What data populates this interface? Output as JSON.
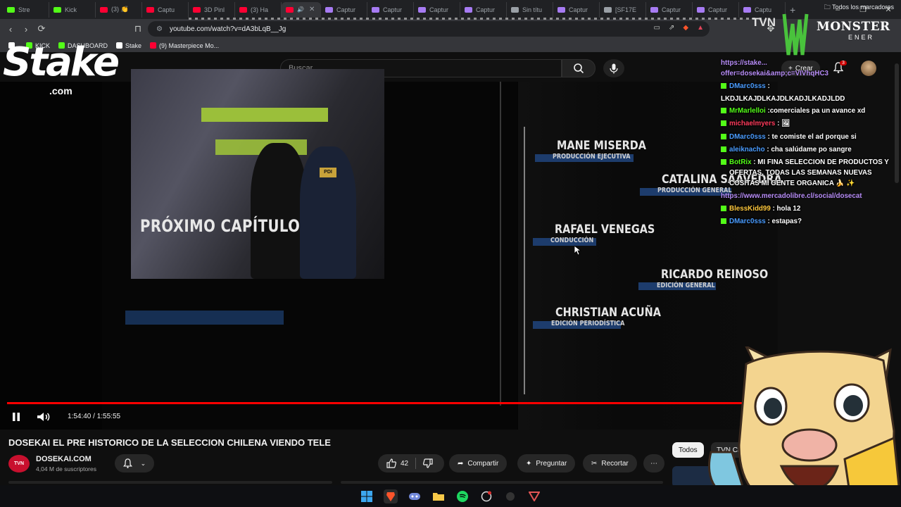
{
  "browser": {
    "tabs": [
      {
        "label": "Stre",
        "color": "#53fc18"
      },
      {
        "label": "Kick",
        "color": "#53fc18"
      },
      {
        "label": "(3) 👏",
        "color": "#ff0033"
      },
      {
        "label": "Captu",
        "color": "#ff0033"
      },
      {
        "label": "3D Pinl",
        "color": "#ff0033"
      },
      {
        "label": "(3) Ha",
        "color": "#ff0033"
      },
      {
        "label": "",
        "color": "#ff0033",
        "active": true
      },
      {
        "label": "Captur",
        "color": "#a77bf3"
      },
      {
        "label": "Captur",
        "color": "#a77bf3"
      },
      {
        "label": "Captur",
        "color": "#a77bf3"
      },
      {
        "label": "Captur",
        "color": "#a77bf3"
      },
      {
        "label": "Sin títu",
        "color": "#9aa0a6"
      },
      {
        "label": "Captur",
        "color": "#a77bf3"
      },
      {
        "label": "[SF17E",
        "color": "#9aa0a6"
      },
      {
        "label": "Captur",
        "color": "#a77bf3"
      },
      {
        "label": "Captur",
        "color": "#a77bf3"
      },
      {
        "label": "Captu",
        "color": "#a77bf3"
      }
    ],
    "new_tab": "+",
    "window_controls": [
      "–",
      "❐",
      "✕"
    ],
    "url": "youtube.com/watch?v=dA3bLqB__Jg",
    "bookmarks": [
      {
        "label": "",
        "color": "#ffffff"
      },
      {
        "label": "KICK",
        "color": "#53fc18"
      },
      {
        "label": "DASHBOARD",
        "color": "#53fc18"
      },
      {
        "label": "Stake",
        "color": "#ffffff"
      },
      {
        "label": "(9) Masterpiece Mo...",
        "color": "#ff0033"
      }
    ],
    "all_bookmarks": "Todos los marcadores"
  },
  "youtube": {
    "search_placeholder": "Buscar",
    "create_label": "Crear",
    "notification_count": "3"
  },
  "overlays": {
    "stake_logo": "Stake",
    "stake_com": ".com",
    "monster_logo": "MONSTER",
    "monster_sub": "ENER"
  },
  "video": {
    "promo_label": "PRÓXIMO CAPÍTULO",
    "network_bug": "TVN",
    "credits": [
      {
        "name": "MANE MISERDA",
        "role": "PRODUCCIÓN EJECUTIVA"
      },
      {
        "name": "CATALINA SAAVEDRA",
        "role": "PRODUCCIÓN GENERAL"
      },
      {
        "name": "RAFAEL VENEGAS",
        "role": "CONDUCCIÓN"
      },
      {
        "name": "RICARDO REINOSO",
        "role": "EDICIÓN GENERAL"
      },
      {
        "name": "CHRISTIAN ACUÑA",
        "role": "EDICIÓN PERIODÍSTICA"
      }
    ],
    "time_current": "1:54:40",
    "time_total": "1:55:55",
    "progress_fraction": 0.989
  },
  "chat": {
    "header_line1": "https://stake...",
    "header_line2": "offer=dosekai&amp;c=VIVhqHC3",
    "messages": [
      {
        "user": "DMarc0sss",
        "user_color": "#4a9cff",
        "text": " :"
      },
      {
        "plain": "LKDJLKAJDLKAJDLKADJLKADJLDD"
      },
      {
        "user": "MrMarlelloi",
        "user_color": "#53fc18",
        "text": " :comerciales pa un avance xd"
      },
      {
        "user": "michaelmyers",
        "user_color": "#ff3b5c",
        "text": " : 🖼"
      },
      {
        "user": "DMarc0sss",
        "user_color": "#4a9cff",
        "text": " : te comiste el ad porque si"
      },
      {
        "user": "aleiknacho",
        "user_color": "#4a9cff",
        "text": " : cha salúdame po sangre"
      },
      {
        "user": "BotRix",
        "user_color": "#53fc18",
        "text": " : MI FINA SELECCION DE PRODUCTOS Y OFERTAS, TODAS LAS SEMANAS NUEVAS COSITAS MI GENTE ORGANICA 🍌 ✨"
      },
      {
        "link": "https://www.mercadolibre.cl/social/dosecat"
      },
      {
        "user": "BlessKidd99",
        "user_color": "#ffc83d",
        "text": " : hola 12"
      },
      {
        "user": "DMarc0sss",
        "user_color": "#4a9cff",
        "text": " : estapas?"
      }
    ]
  },
  "below": {
    "title": "DOSEKAI EL PRE HISTORICO DE LA SELECCION CHILENA VIENDO TELE",
    "channel_avatar": "TVN",
    "channel_name": "DOSEKAI.COM",
    "subscribers": "4,04 M de suscriptores",
    "likes": "42",
    "share": "Compartir",
    "ask": "Preguntar",
    "clip": "Recortar",
    "more": "⋯",
    "chips": [
      "Todos",
      "TVN Ch"
    ]
  }
}
